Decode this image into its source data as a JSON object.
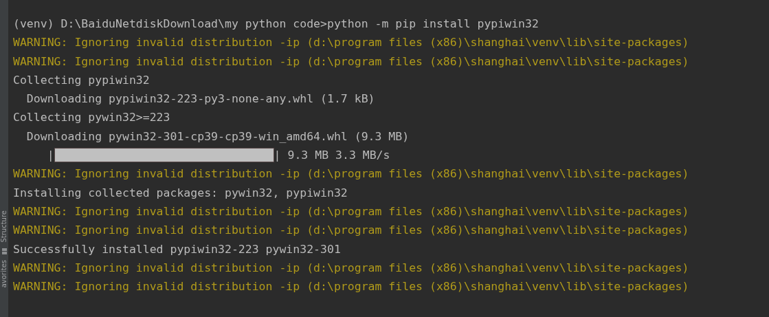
{
  "side_tabs": [
    {
      "kind": "tab",
      "label": "Structure"
    },
    {
      "kind": "icon"
    },
    {
      "kind": "tab",
      "label": "avorites"
    }
  ],
  "lines": [
    {
      "kind": "normal",
      "text": "(venv) D:\\BaiduNetdiskDownload\\my python code>python -m pip install pypiwin32"
    },
    {
      "kind": "warning",
      "text": "WARNING: Ignoring invalid distribution -ip (d:\\program files (x86)\\shanghai\\venv\\lib\\site-packages)"
    },
    {
      "kind": "warning",
      "text": "WARNING: Ignoring invalid distribution -ip (d:\\program files (x86)\\shanghai\\venv\\lib\\site-packages)"
    },
    {
      "kind": "normal",
      "text": "Collecting pypiwin32"
    },
    {
      "kind": "normal",
      "text": "  Downloading pypiwin32-223-py3-none-any.whl (1.7 kB)"
    },
    {
      "kind": "normal",
      "text": "Collecting pywin32>=223"
    },
    {
      "kind": "normal",
      "text": "  Downloading pywin32-301-cp39-cp39-win_amd64.whl (9.3 MB)"
    },
    {
      "kind": "progress",
      "prefix": "     |",
      "level": 1,
      "suffix": "| 9.3 MB 3.3 MB/s"
    },
    {
      "kind": "warning",
      "text": "WARNING: Ignoring invalid distribution -ip (d:\\program files (x86)\\shanghai\\venv\\lib\\site-packages)"
    },
    {
      "kind": "normal",
      "text": "Installing collected packages: pywin32, pypiwin32"
    },
    {
      "kind": "warning",
      "text": "WARNING: Ignoring invalid distribution -ip (d:\\program files (x86)\\shanghai\\venv\\lib\\site-packages)"
    },
    {
      "kind": "warning",
      "text": "WARNING: Ignoring invalid distribution -ip (d:\\program files (x86)\\shanghai\\venv\\lib\\site-packages)"
    },
    {
      "kind": "normal",
      "text": "Successfully installed pypiwin32-223 pywin32-301"
    },
    {
      "kind": "warning",
      "text": "WARNING: Ignoring invalid distribution -ip (d:\\program files (x86)\\shanghai\\venv\\lib\\site-packages)"
    },
    {
      "kind": "warning",
      "text": "WARNING: Ignoring invalid distribution -ip (d:\\program files (x86)\\shanghai\\venv\\lib\\site-packages)"
    }
  ]
}
